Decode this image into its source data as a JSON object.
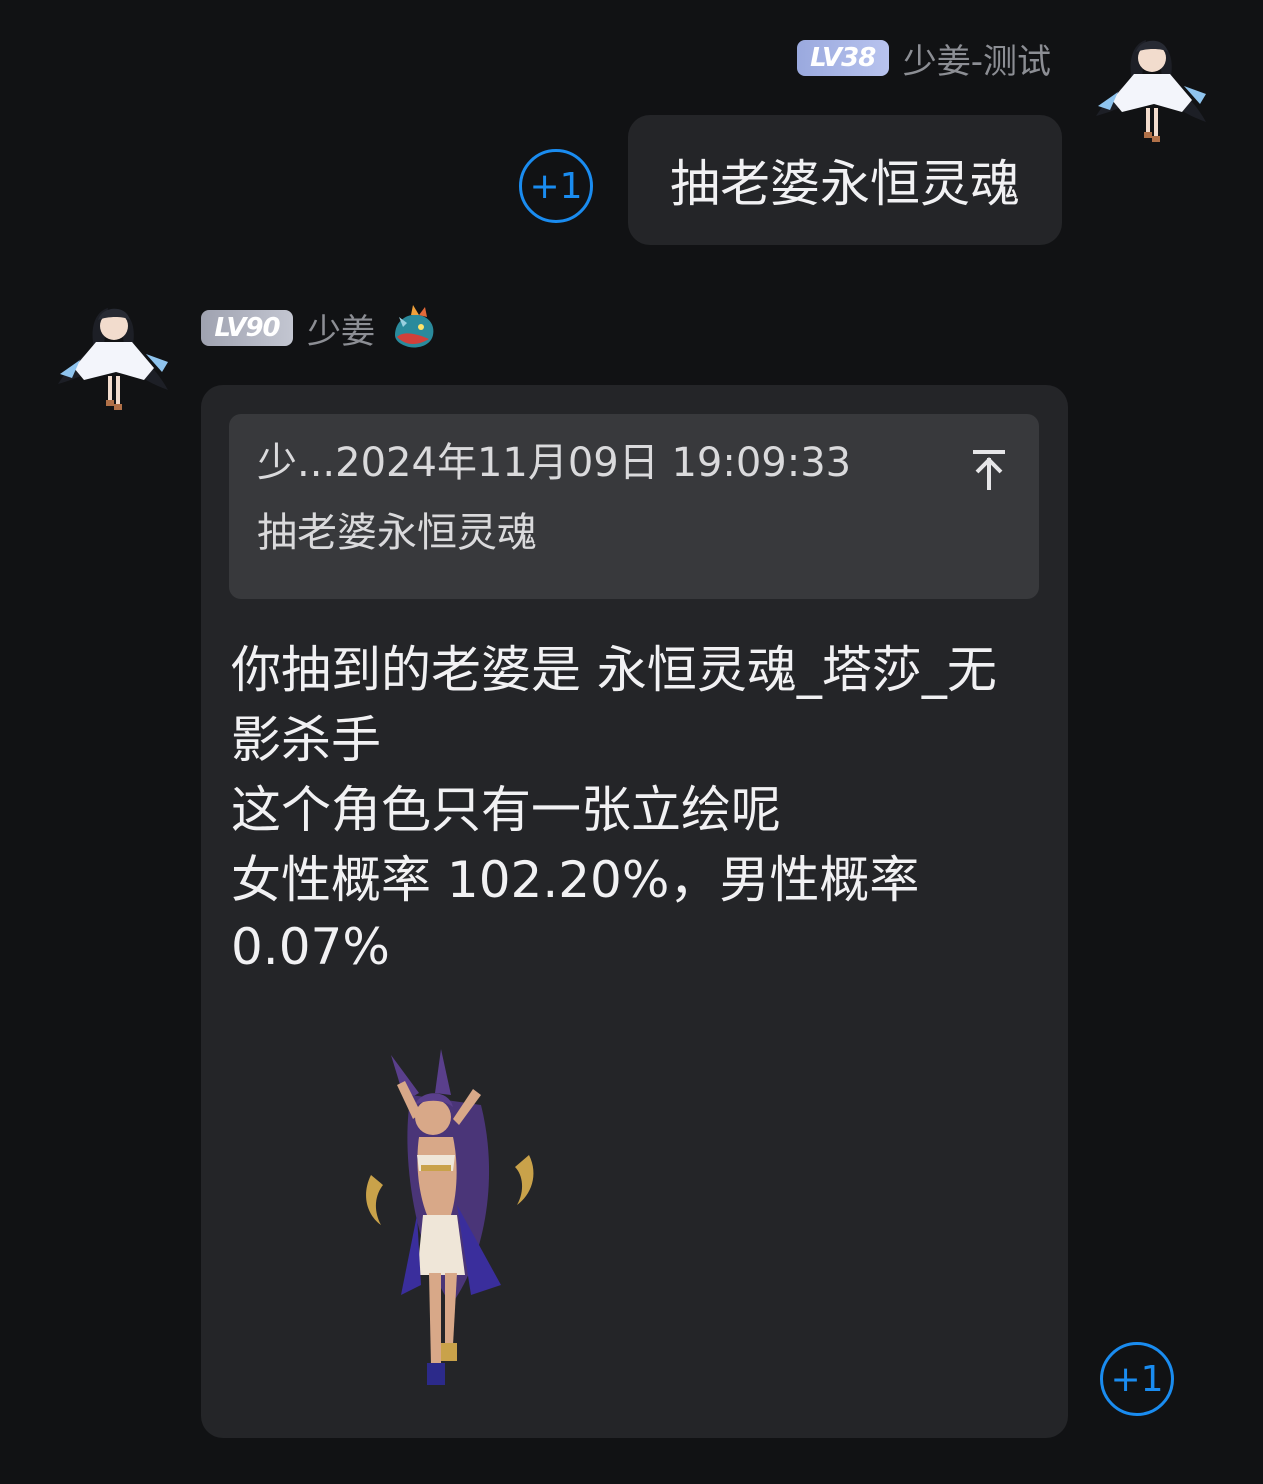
{
  "messages": {
    "self": {
      "level": "LV38",
      "nickname": "少姜-测试",
      "text": "抽老婆永恒灵魂",
      "plus_one": "+1",
      "avatar_icon": "anime-girl-avatar-icon"
    },
    "other": {
      "level": "LV90",
      "nickname": "少姜",
      "badge_icon": "dragon-icon",
      "avatar_icon": "anime-girl-avatar-icon",
      "quote": {
        "header": "少...2024年11月09日 19:09:33",
        "body": "抽老婆永恒灵魂",
        "jump_icon": "jump-to-top-icon"
      },
      "reply_lines": [
        "你抽到的老婆是 永恒灵魂_塔莎_无",
        "影杀手",
        "这个角色只有一张立绘呢",
        "女性概率 102.20%，男性概率",
        "0.07%"
      ],
      "image_icon": "character-illustration-image",
      "plus_one": "+1"
    }
  },
  "colors": {
    "background": "#111214",
    "bubble": "#242528",
    "quote_card": "#38393c",
    "accent_blue": "#1a8cf0",
    "nickname_gray": "#8c8e94"
  }
}
